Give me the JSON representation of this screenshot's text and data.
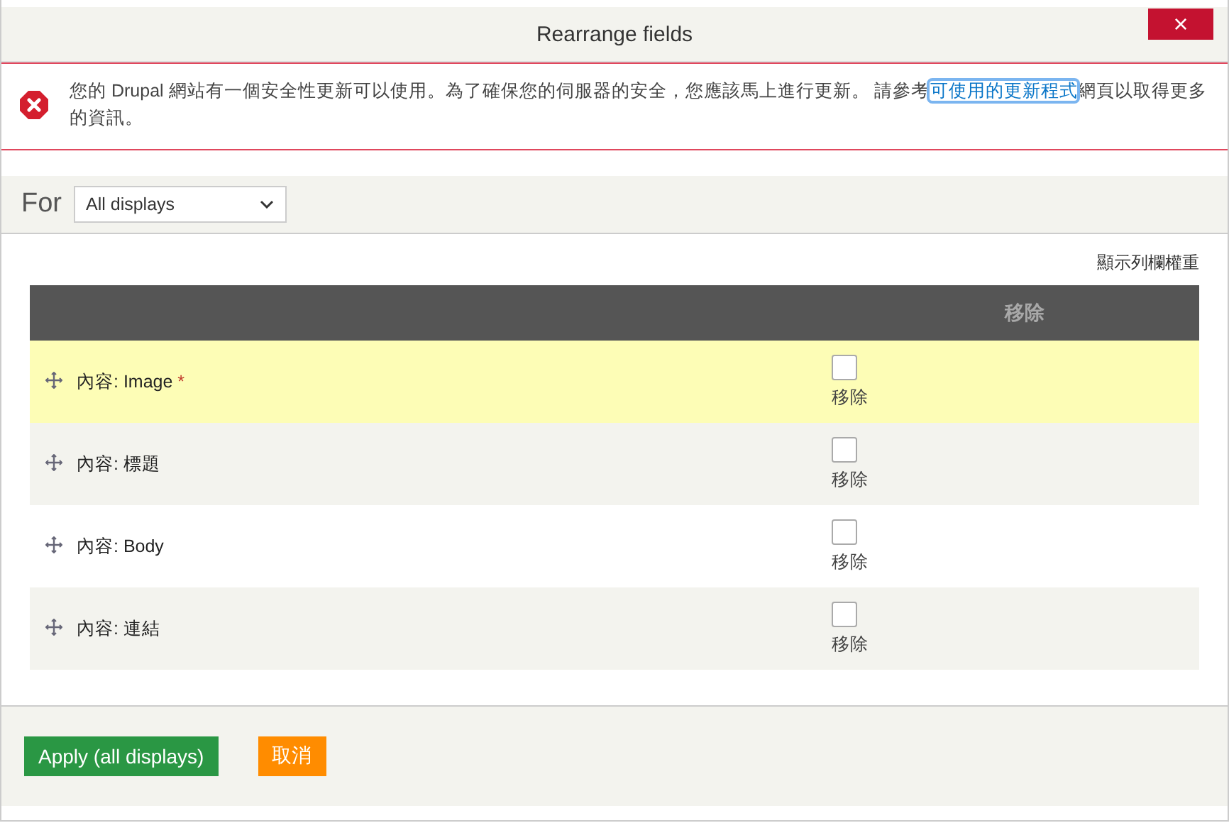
{
  "dialog": {
    "title": "Rearrange fields",
    "close_label": "×"
  },
  "message": {
    "text_before": "您的 Drupal 網站有一個安全性更新可以使用。為了確保您的伺服器的安全，您應該馬上進行更新。 請參考",
    "link": "可使用的更新程式",
    "text_after": "網頁以取得更多的資訊。"
  },
  "display_filter": {
    "label": "For",
    "value": "All displays"
  },
  "weights_link": "顯示列欄權重",
  "table": {
    "columns": [
      "移除"
    ],
    "rows": [
      {
        "label": "內容: Image",
        "required_mark": "*",
        "highlighted": true,
        "checked": false,
        "remove_label": "移除"
      },
      {
        "label": "內容: 標題",
        "highlighted": false,
        "checked": false,
        "remove_label": "移除"
      },
      {
        "label": "內容: Body",
        "highlighted": false,
        "checked": false,
        "remove_label": "移除"
      },
      {
        "label": "內容: 連結",
        "highlighted": false,
        "checked": false,
        "remove_label": "移除"
      }
    ]
  },
  "buttons": [
    {
      "kind": "primary",
      "label": "Apply (all displays)"
    },
    {
      "kind": "cancel",
      "label": "取消"
    }
  ]
}
